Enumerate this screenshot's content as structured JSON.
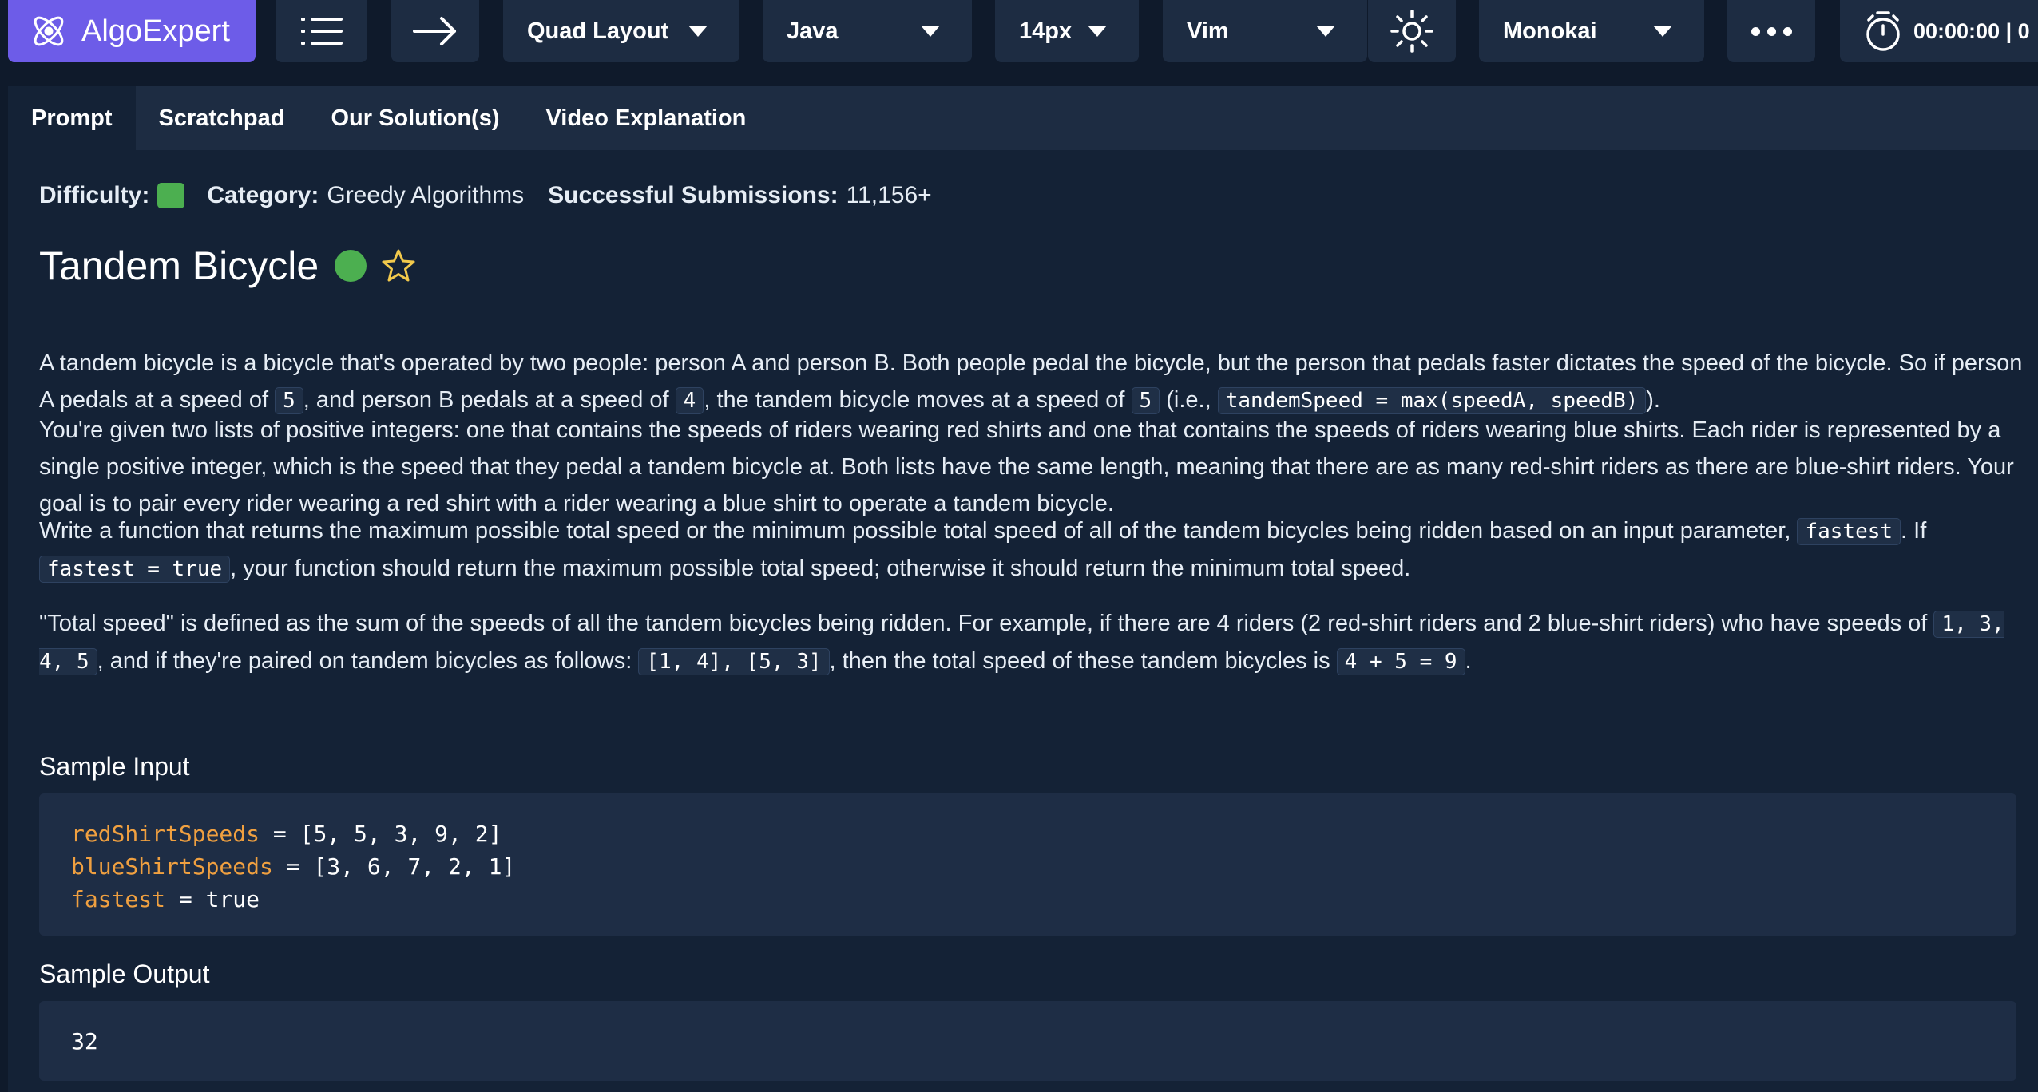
{
  "toolbar": {
    "brand": "AlgoExpert",
    "layout": "Quad Layout",
    "language": "Java",
    "font_size": "14px",
    "keybindings": "Vim",
    "scheme": "Monokai",
    "timer": "00:00:00 | 0"
  },
  "tabs": [
    "Prompt",
    "Scratchpad",
    "Our Solution(s)",
    "Video Explanation"
  ],
  "meta": {
    "difficulty_label": "Difficulty:",
    "category_label": "Category:",
    "category": "Greedy Algorithms",
    "submissions_label": "Successful Submissions:",
    "submissions": "11,156+"
  },
  "title": "Tandem Bicycle",
  "p1": {
    "t1": "A tandem bicycle is a bicycle that's operated by two people: person A and person B. Both people pedal the bicycle, but the person that pedals faster dictates the speed of the bicycle. So if person A pedals at a speed of ",
    "c1": "5",
    "t2": ", and person B pedals at a speed of ",
    "c2": "4",
    "t3": ", the tandem bicycle moves at a speed of ",
    "c3": "5",
    "t4": " (i.e., ",
    "c4": "tandemSpeed = max(speedA, speedB)",
    "t5": ")."
  },
  "p2": "You're given two lists of positive integers: one that contains the speeds of riders wearing red shirts and one that contains the speeds of riders wearing blue shirts. Each rider is represented by a single positive integer, which is the speed that they pedal a tandem bicycle at. Both lists have the same length, meaning that there are as many red-shirt riders as there are blue-shirt riders. Your goal is to pair every rider wearing a red shirt with a rider wearing a blue shirt to operate a tandem bicycle.",
  "p3": {
    "t1": "Write a function that returns the maximum possible total speed or the minimum possible total speed of all of the tandem bicycles being ridden based on an input parameter, ",
    "c1": "fastest",
    "t2": ". If ",
    "c2": "fastest = true",
    "t3": ", your function should return the maximum possible total speed; otherwise it should return the minimum total speed."
  },
  "p4": {
    "t1": "\"Total speed\" is defined as the sum of the speeds of all the tandem bicycles being ridden. For example, if there are 4 riders (2 red-shirt riders and 2 blue-shirt riders) who have speeds of ",
    "c1": "1, 3, 4, 5",
    "t2": ", and if they're paired on tandem bicycles as follows: ",
    "c2": "[1, 4], [5, 3]",
    "t3": ", then the total speed of these tandem bicycles is ",
    "c3": "4 + 5 = 9",
    "t4": "."
  },
  "sample_input_label": "Sample Input",
  "sample_input": [
    {
      "var": "redShirtSpeeds",
      "rest": " = [5, 5, 3, 9, 2]"
    },
    {
      "var": "blueShirtSpeeds",
      "rest": " = [3, 6, 7, 2, 1]"
    },
    {
      "var": "fastest",
      "rest": " = true"
    }
  ],
  "sample_output_label": "Sample Output",
  "sample_output": "32",
  "colors": {
    "brand": "#6d5ce8",
    "panel": "#1d2c42",
    "content_bg": "#142236",
    "easy": "#4caf50",
    "code_var": "#f0a040"
  }
}
